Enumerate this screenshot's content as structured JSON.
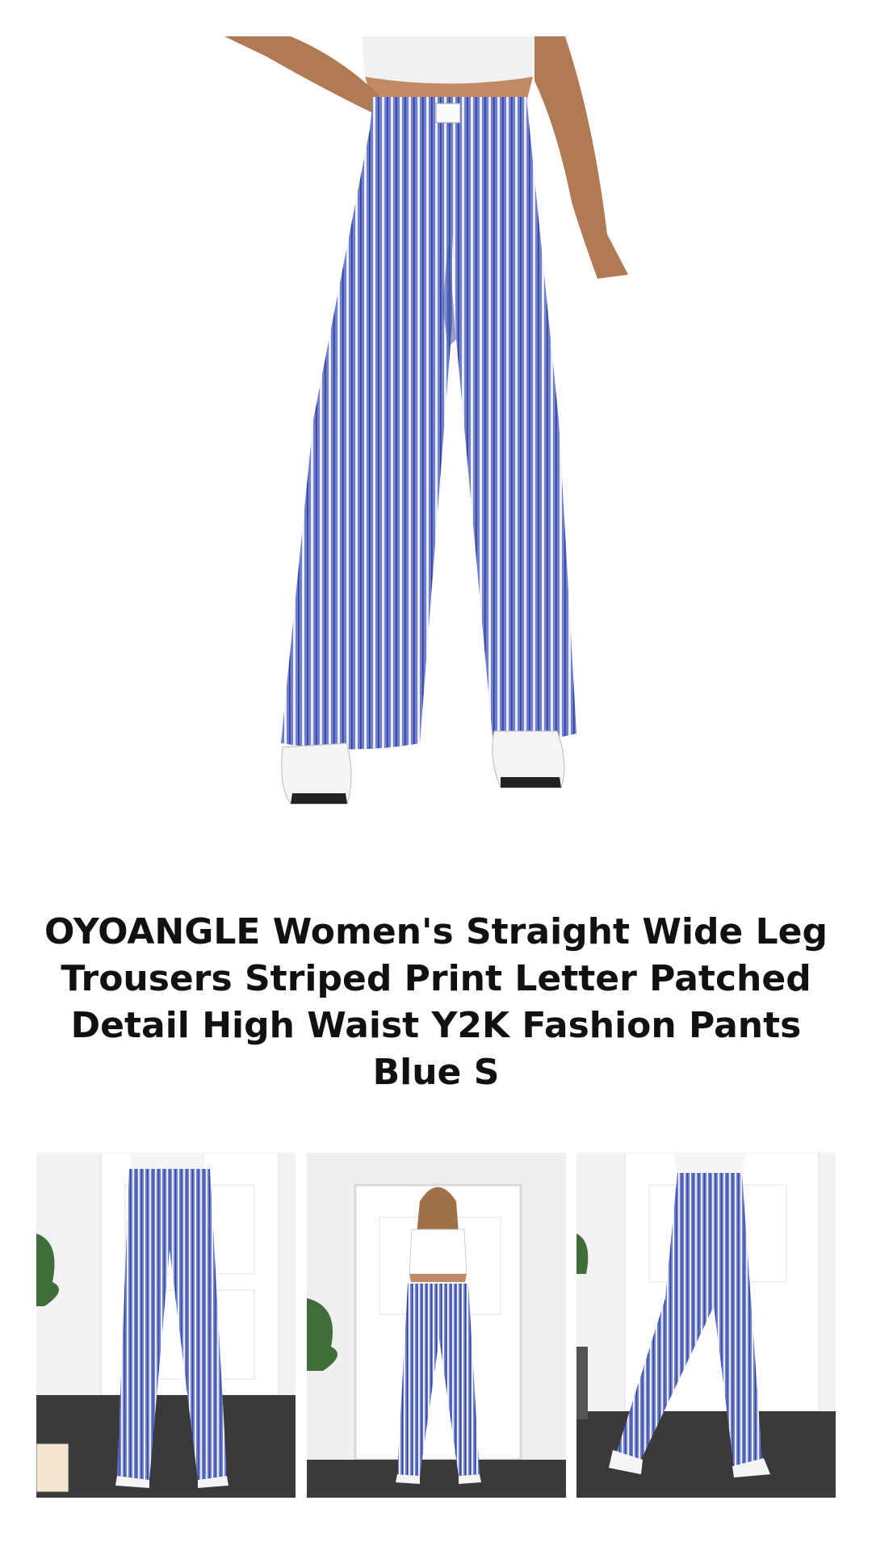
{
  "product": {
    "title": "OYOANGLE Women's Straight Wide Leg Trousers Striped Print Letter Patched Detail High Waist Y2K Fashion Pants Blue S"
  },
  "images": {
    "hero_alt": "",
    "thumbnails": [
      {
        "view": "back"
      },
      {
        "view": "front-full"
      },
      {
        "view": "side"
      }
    ]
  },
  "colors": {
    "pants_base": "#6f7fd0",
    "pants_stripe": "#e9ecfb",
    "background": "#ffffff",
    "title_text": "#111111"
  }
}
